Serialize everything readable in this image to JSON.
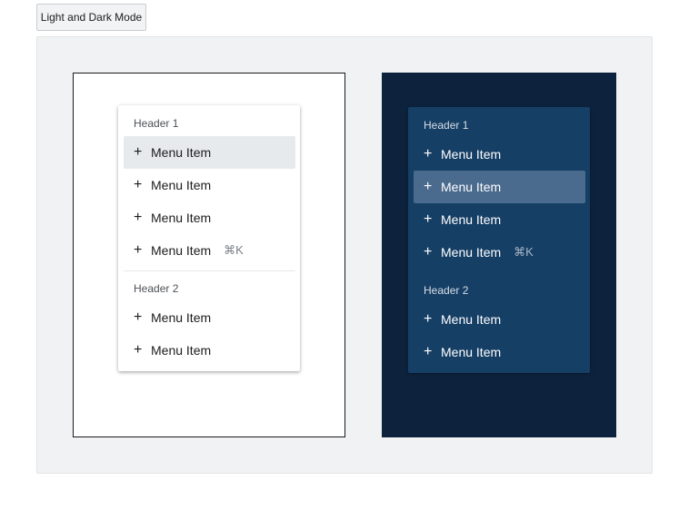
{
  "toggle_button": {
    "label": "Light and Dark Mode"
  },
  "light_menu": {
    "header1": "Header 1",
    "header2": "Header 2",
    "items": [
      {
        "icon": "+",
        "label": "Menu Item",
        "shortcut": ""
      },
      {
        "icon": "+",
        "label": "Menu Item",
        "shortcut": ""
      },
      {
        "icon": "+",
        "label": "Menu Item",
        "shortcut": ""
      },
      {
        "icon": "+",
        "label": "Menu Item",
        "shortcut": "⌘K"
      },
      {
        "icon": "+",
        "label": "Menu Item",
        "shortcut": ""
      },
      {
        "icon": "+",
        "label": "Menu Item",
        "shortcut": ""
      }
    ],
    "hovered_item_index": 0
  },
  "dark_menu": {
    "header1": "Header 1",
    "header2": "Header 2",
    "items": [
      {
        "icon": "+",
        "label": "Menu Item",
        "shortcut": ""
      },
      {
        "icon": "+",
        "label": "Menu Item",
        "shortcut": ""
      },
      {
        "icon": "+",
        "label": "Menu Item",
        "shortcut": ""
      },
      {
        "icon": "+",
        "label": "Menu Item",
        "shortcut": "⌘K"
      },
      {
        "icon": "+",
        "label": "Menu Item",
        "shortcut": ""
      },
      {
        "icon": "+",
        "label": "Menu Item",
        "shortcut": ""
      }
    ],
    "hovered_item_index": 1
  },
  "colors": {
    "stage_background": "#f1f2f4",
    "dark_frame_background": "#0d233d",
    "dark_menu_background": "#163f66",
    "dark_hover": "#4a6a8e",
    "light_hover": "#e7eaed"
  }
}
